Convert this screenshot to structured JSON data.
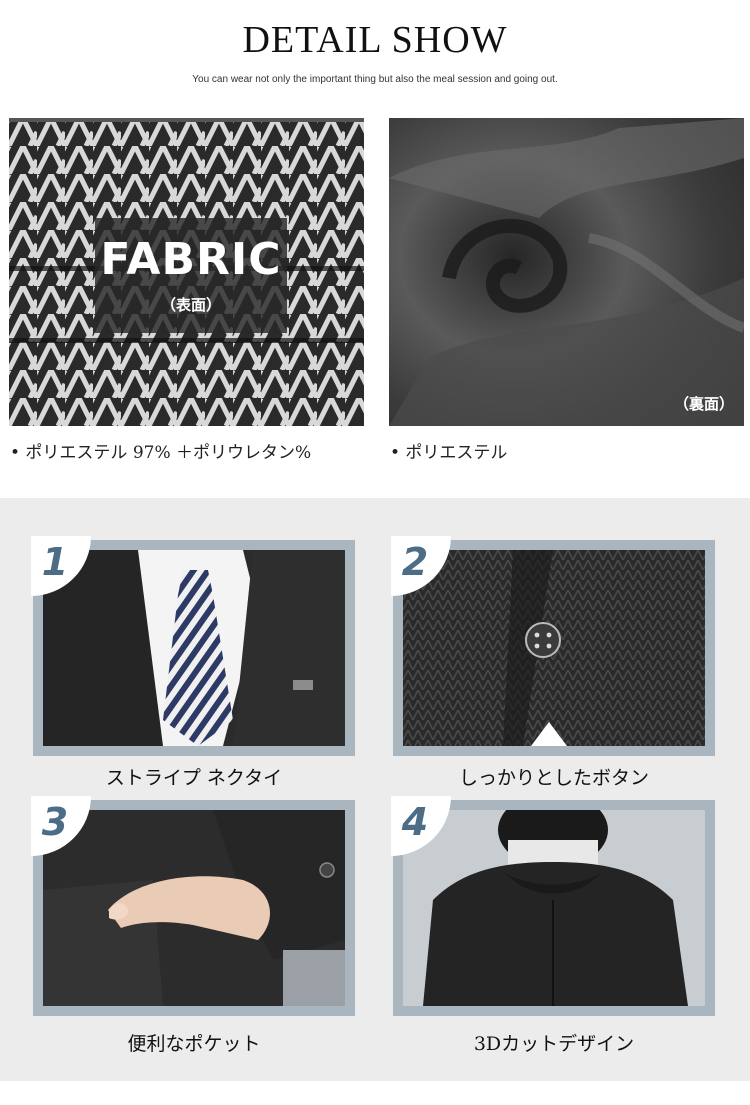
{
  "header": {
    "title": "DETAIL SHOW",
    "subtitle": "You can wear not only the important thing but also the meal session and going out."
  },
  "fabric": {
    "front": {
      "overlay_title": "FABRIC",
      "overlay_tag": "（表面）",
      "bullet": "• ポリエステル 97% ＋ポリウレタン%"
    },
    "back": {
      "overlay_tag": "（裏面）",
      "bullet": "• ポリエステル"
    }
  },
  "details": [
    {
      "number": "1",
      "caption": "ストライプ ネクタイ"
    },
    {
      "number": "2",
      "caption": "しっかりとしたボタン"
    },
    {
      "number": "3",
      "caption": "便利なポケット"
    },
    {
      "number": "4",
      "caption": "3Dカットデザイン"
    }
  ],
  "colors": {
    "card_frame": "#a9b6c0",
    "number_badge_text": "#4d6d86",
    "panel_background": "#ececec"
  }
}
